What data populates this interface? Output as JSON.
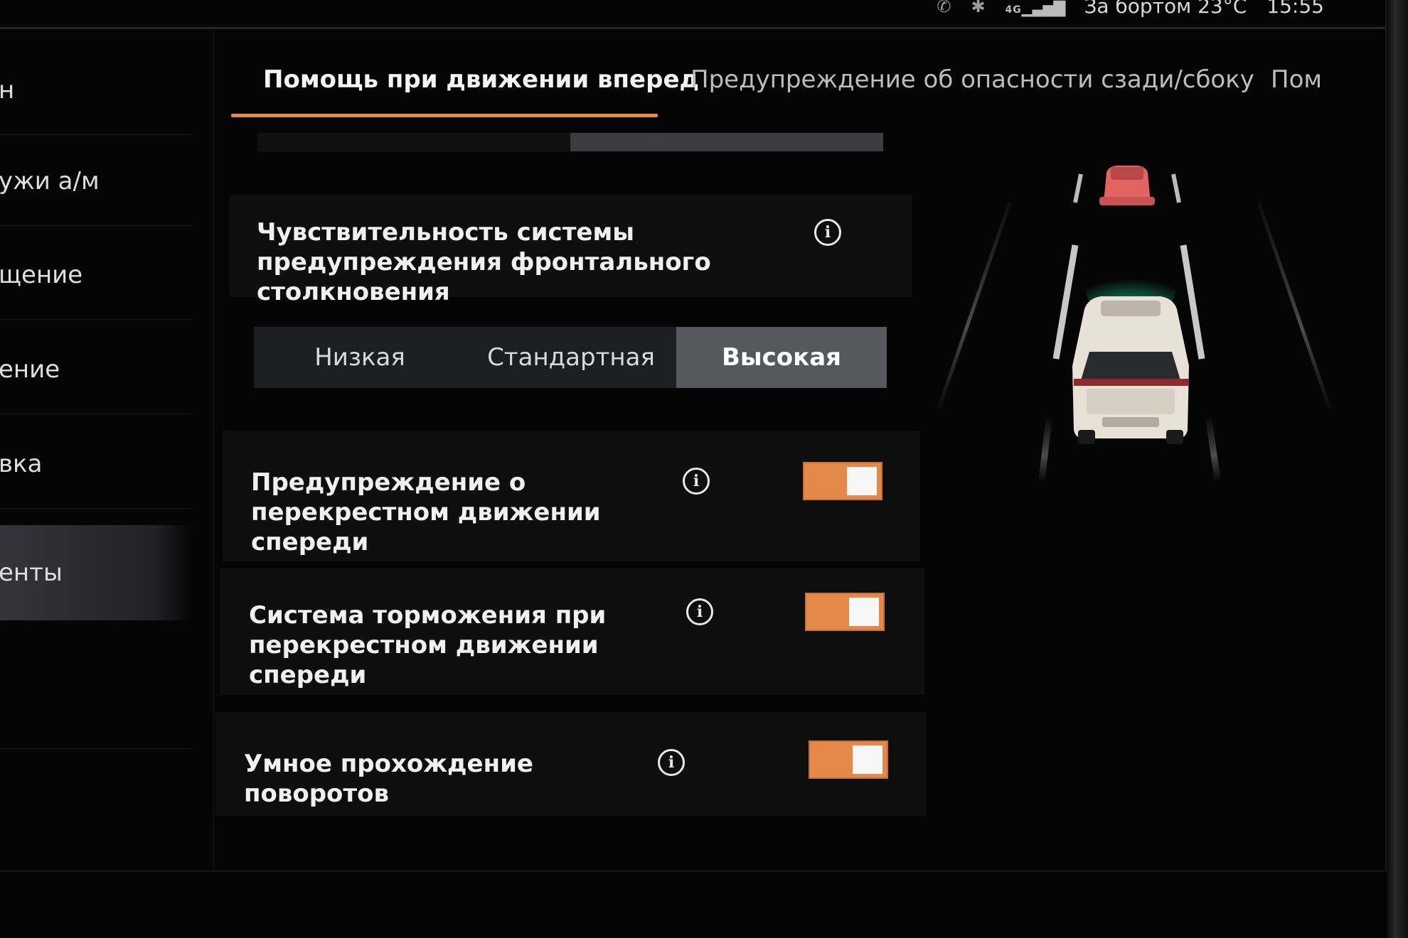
{
  "status": {
    "network": "4G",
    "outside_temp": "За бортом 23°C",
    "time": "15:55"
  },
  "sidebar": {
    "items": [
      {
        "label": "н"
      },
      {
        "label": "ужи а/м"
      },
      {
        "label": "щение"
      },
      {
        "label": "ение"
      },
      {
        "label": "вка"
      },
      {
        "label": "енты"
      }
    ]
  },
  "tabs": [
    {
      "label": "Помощь при движении вперед"
    },
    {
      "label": "Предупреждение об опасности сзади/сбоку"
    },
    {
      "label": "Пом"
    }
  ],
  "sensitivity": {
    "title": "Чувствительность системы предупреждения фронтального столкновения",
    "options": [
      "Низкая",
      "Стандартная",
      "Высокая"
    ],
    "selected": "Высокая"
  },
  "toggles": [
    {
      "label": "Предупреждение о перекрестном движении спереди",
      "on": true
    },
    {
      "label": "Система торможения при перекрестном движении спереди",
      "on": true
    },
    {
      "label": "Умное прохождение поворотов",
      "on": true
    }
  ],
  "colors": {
    "accent": "#e38d44",
    "toggle_on": "#e5894a",
    "lead_vehicle": "#e36262",
    "detection_zone": "#1fd49a"
  },
  "icons": {
    "info": "info-icon",
    "bluetooth": "bluetooth-icon",
    "phone": "phone-icon",
    "signal": "signal-icon"
  }
}
